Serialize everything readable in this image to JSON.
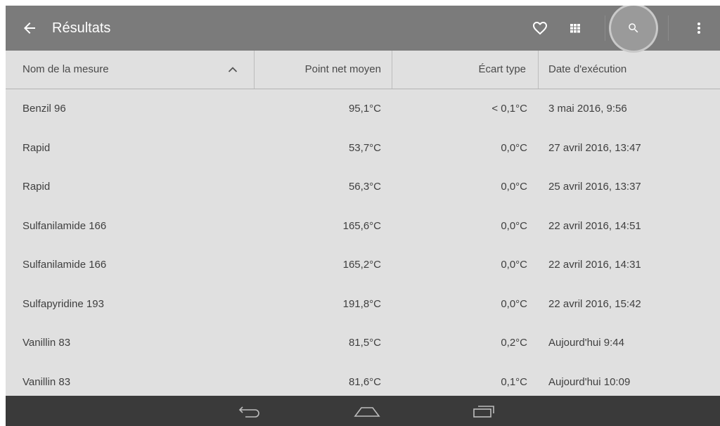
{
  "appbar": {
    "title": "Résultats",
    "icons": [
      "back-arrow-icon",
      "heart-icon",
      "grid-icon",
      "search-icon",
      "more-vert-icon"
    ]
  },
  "table": {
    "headers": {
      "name": "Nom de la mesure",
      "mean": "Point net moyen",
      "std": "Écart type",
      "date": "Date d'exécution"
    },
    "sort": "ascending",
    "rows": [
      {
        "name": "Benzil 96",
        "mean": "95,1°C",
        "std": "< 0,1°C",
        "date": "3 mai 2016, 9:56"
      },
      {
        "name": "Rapid",
        "mean": "53,7°C",
        "std": "0,0°C",
        "date": "27 avril 2016, 13:47"
      },
      {
        "name": "Rapid",
        "mean": "56,3°C",
        "std": "0,0°C",
        "date": "25 avril 2016, 13:37"
      },
      {
        "name": "Sulfanilamide 166",
        "mean": "165,6°C",
        "std": "0,0°C",
        "date": "22 avril 2016, 14:51"
      },
      {
        "name": "Sulfanilamide 166",
        "mean": "165,2°C",
        "std": "0,0°C",
        "date": "22 avril 2016, 14:31"
      },
      {
        "name": "Sulfapyridine 193",
        "mean": "191,8°C",
        "std": "0,0°C",
        "date": "22 avril 2016, 15:42"
      },
      {
        "name": "Vanillin 83",
        "mean": "81,5°C",
        "std": "0,2°C",
        "date": "Aujourd'hui 9:44"
      },
      {
        "name": "Vanillin 83",
        "mean": "81,6°C",
        "std": "0,1°C",
        "date": "Aujourd'hui 10:09"
      }
    ]
  },
  "navbar": {
    "icons": [
      "nav-back-icon",
      "nav-home-icon",
      "nav-recents-icon"
    ]
  },
  "colors": {
    "appbar": "#7b7b7b",
    "background": "#e0e0e0",
    "navbar": "#3a3a3a"
  }
}
